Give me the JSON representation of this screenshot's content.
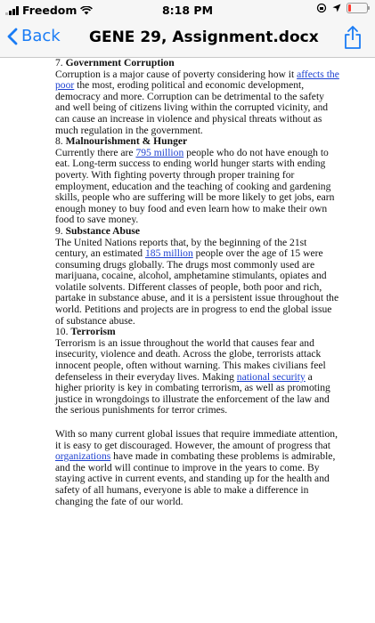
{
  "status_bar": {
    "carrier": "Freedom",
    "time": "8:18 PM"
  },
  "nav": {
    "back_label": "Back",
    "title": "GENE 29, Assignment.docx",
    "accent_color": "#1a7cf5"
  },
  "document": {
    "s7": {
      "heading_num": "7.",
      "heading": "Government Corruption",
      "t1": "Corruption is a major cause of poverty considering how it ",
      "link": "affects the poor",
      "t2": " the most, eroding political and economic development, democracy and more. Corruption can be detrimental to the safety and well being of citizens living within the corrupted vicinity, and can cause an increase in violence and physical threats without as much regulation in the government."
    },
    "s8": {
      "heading_num": "8.",
      "heading": "Malnourishment & Hunger",
      "t1": "Currently there are ",
      "link": "795 million",
      "t2": " people who do not have enough to eat. Long-term success to ending world hunger starts with ending poverty. With fighting poverty through proper training for employment, education and the teaching of cooking and gardening skills, people who are suffering will be more likely to get jobs, earn enough money to buy food and even learn how to make their own food to save money."
    },
    "s9": {
      "heading_num": "9.",
      "heading": "Substance Abuse",
      "t1": "The United Nations reports that, by the beginning of the 21st century, an estimated ",
      "link": "185 million",
      "t2": " people over the age of 15 were consuming drugs globally. The drugs most commonly used are marijuana, cocaine, alcohol, amphetamine stimulants, opiates and volatile solvents. Different classes of people, both poor and rich, partake in substance abuse, and it is a persistent issue throughout the world. Petitions and projects are in progress to end the global issue of substance abuse."
    },
    "s10": {
      "heading_num": "10.",
      "heading": "Terrorism",
      "t1": "Terrorism is an issue throughout the world that causes fear and insecurity, violence and death. Across the globe, terrorists attack innocent people, often without warning. This makes civilians feel defenseless in their everyday lives. Making ",
      "link": "national security",
      "t2": " a higher priority is key in combating terrorism, as well as promoting justice in wrongdoings to illustrate the enforcement of the law and the serious punishments for terror crimes."
    },
    "conclusion": {
      "t1": "With so many current global issues that require immediate attention, it is easy to get discouraged. However, the amount of progress that ",
      "link": "organizations",
      "t2": " have made in combating these problems is admirable, and the world will continue to improve in the years to come. By staying active in current events, and standing up for the health and safety of all humans, everyone is able to make a difference in changing the fate of our world."
    }
  }
}
